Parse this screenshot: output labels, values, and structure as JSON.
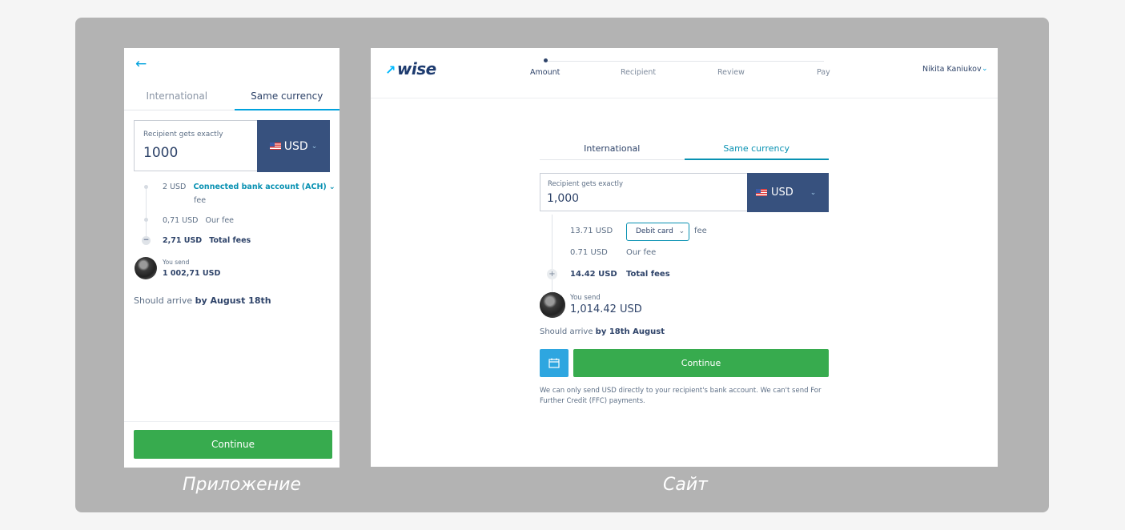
{
  "captions": {
    "app": "Приложение",
    "site": "Сайт"
  },
  "app": {
    "back_icon": "arrow-left-icon",
    "tabs": [
      "International",
      "Same currency"
    ],
    "amount": {
      "label": "Recipient gets exactly",
      "value": "1000",
      "currency": "USD"
    },
    "fees": {
      "method_amount": "2 USD",
      "method_label": "Connected bank account (ACH)",
      "method_suffix": "fee",
      "our_fee_amount": "0,71 USD",
      "our_fee_label": "Our fee",
      "total_amount": "2,71 USD",
      "total_label": "Total fees"
    },
    "send": {
      "label": "You send",
      "value": "1 002,71 USD"
    },
    "arrive": {
      "prefix": "Should arrive",
      "date": "by August 18th"
    },
    "continue_label": "Continue"
  },
  "site": {
    "logo": "wise",
    "steps": [
      "Amount",
      "Recipient",
      "Review",
      "Pay"
    ],
    "user": {
      "name": "Nikita Kaniukov"
    },
    "tabs": [
      "International",
      "Same currency"
    ],
    "amount": {
      "label": "Recipient gets exactly",
      "value": "1,000",
      "currency": "USD"
    },
    "fees": {
      "method_amount": "13.71 USD",
      "method_select": "Debit card",
      "method_suffix": "fee",
      "our_fee_amount": "0.71 USD",
      "our_fee_label": "Our fee",
      "total_amount": "14.42 USD",
      "total_label": "Total fees"
    },
    "send": {
      "label": "You send",
      "value": "1,014.42 USD"
    },
    "arrive": {
      "prefix": "Should arrive",
      "date": "by 18th August"
    },
    "continue_label": "Continue",
    "note": "We can only send USD directly to your recipient's bank account. We can't send For Further Credit (FFC) payments."
  },
  "colors": {
    "accent": "#00a2dd",
    "navy": "#37517e",
    "green": "#37ab4e"
  }
}
